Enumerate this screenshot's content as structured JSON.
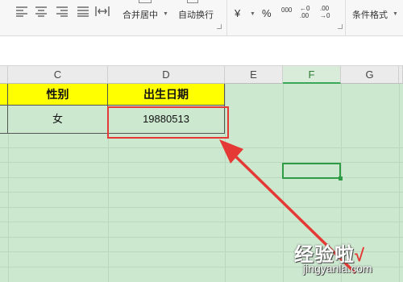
{
  "ribbon": {
    "merge_center_label": "合并居中",
    "wrap_text_label": "自动换行",
    "currency_symbol": "¥",
    "percent_symbol": "%",
    "thousands_symbol": "000",
    "increase_decimal_symbol": "←0\n.00",
    "decrease_decimal_symbol": ".00\n→0",
    "conditional_format_label": "条件格式"
  },
  "columns": [
    {
      "label": "C"
    },
    {
      "label": "D"
    },
    {
      "label": "E"
    },
    {
      "label": "F"
    },
    {
      "label": "G"
    }
  ],
  "table": {
    "headers": [
      "性别",
      "出生日期"
    ],
    "row": [
      "女",
      "19880513"
    ]
  },
  "colors": {
    "header_fill": "#ffff00",
    "sheet_background": "#cce8cf",
    "highlight_box": "#e53935",
    "active_cell": "#2e9c44"
  },
  "watermark": {
    "title": "经验啦",
    "url": "jingyanla.com"
  }
}
